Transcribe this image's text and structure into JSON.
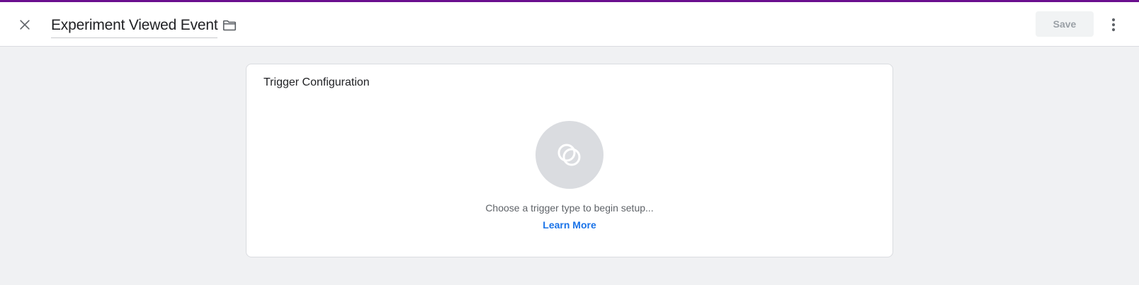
{
  "header": {
    "title": "Experiment Viewed Event",
    "save_label": "Save",
    "close_icon": "close-icon",
    "folder_icon": "folder-icon",
    "more_icon": "more-vert-icon"
  },
  "card": {
    "title": "Trigger Configuration",
    "trigger_icon": "trigger-type-icon",
    "hint": "Choose a trigger type to begin setup...",
    "learn_more": "Learn More"
  },
  "colors": {
    "accent_bar": "#6a0f8e",
    "link": "#1a73e8",
    "background": "#f0f1f3"
  }
}
